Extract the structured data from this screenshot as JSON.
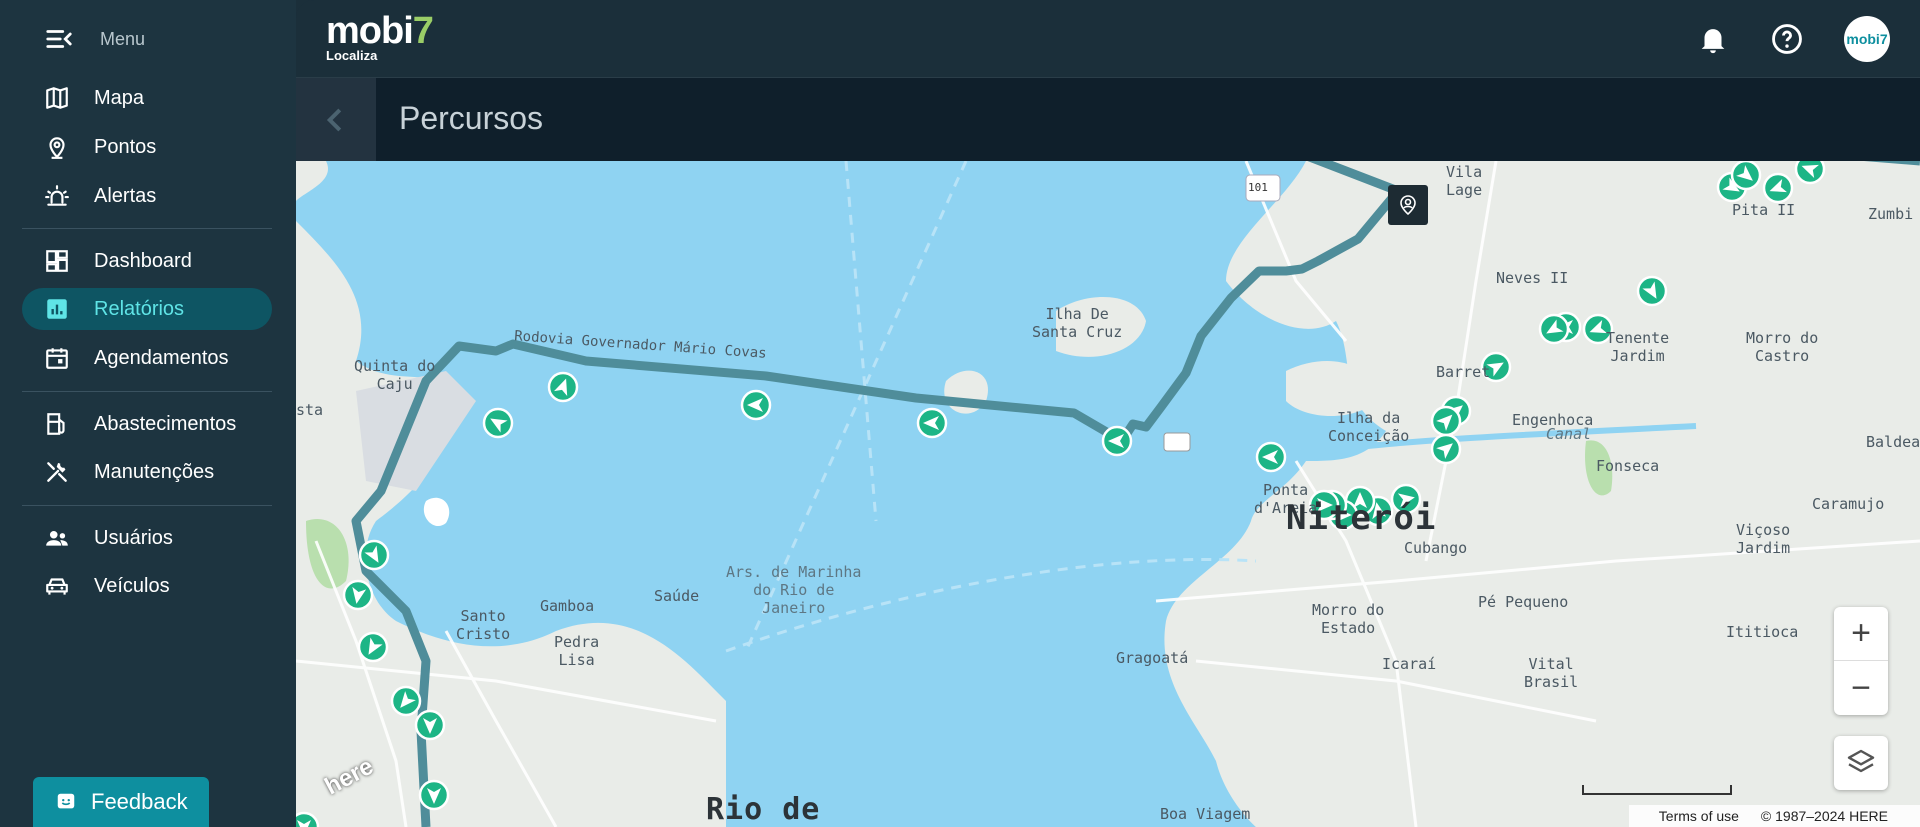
{
  "sidebar": {
    "menu_label": "Menu",
    "groups": [
      [
        {
          "label": "Mapa",
          "icon": "map-icon"
        },
        {
          "label": "Pontos",
          "icon": "location-pin-icon"
        },
        {
          "label": "Alertas",
          "icon": "siren-icon"
        }
      ],
      [
        {
          "label": "Dashboard",
          "icon": "dashboard-icon"
        },
        {
          "label": "Relatórios",
          "icon": "bar-chart-icon",
          "active": true
        },
        {
          "label": "Agendamentos",
          "icon": "calendar-icon"
        }
      ],
      [
        {
          "label": "Abastecimentos",
          "icon": "fuel-pump-icon"
        },
        {
          "label": "Manutenções",
          "icon": "wrench-icon"
        }
      ],
      [
        {
          "label": "Usuários",
          "icon": "users-icon"
        },
        {
          "label": "Veículos",
          "icon": "car-icon"
        }
      ]
    ],
    "feedback_label": "Feedback"
  },
  "topbar": {
    "logo_text": "mobi",
    "logo_accent": "7",
    "logo_sub": "Localiza",
    "avatar_text": "mobi7"
  },
  "page": {
    "title": "Percursos"
  },
  "map": {
    "labels": {
      "vila_lage": "Vila\nLage",
      "pita_ii": "Pita II",
      "zumbi": "Zumbi",
      "neves_ii": "Neves II",
      "ilha_santa_cruz": "Ilha De\nSanta Cruz",
      "tenente_jardim": "Tenente\nJardim",
      "morro_castro": "Morro do\nCastro",
      "barreto": "Barret",
      "ilha_conceicao": "Ilha da\nConceição",
      "engenhoca": "Engenhoca",
      "baldeador": "Baldead",
      "quinta_caju": "Quinta do\nCaju",
      "ponta_areia": "Ponta\nd'Areia",
      "canal": "Canal",
      "fonseca": "Fonseca",
      "caramujo": "Caramujo",
      "niteroi": "Niterói",
      "cubango": "Cubango",
      "vicoso_jardim": "Viçoso\nJardim",
      "ars_marinha": "Ars. de Marinha\ndo Rio de\nJaneiro",
      "gamboa": "Gamboa",
      "saude": "Saúde",
      "santo_cristo": "Santo\nCristo",
      "pedra_lisa": "Pedra\nLisa",
      "morro_estado": "Morro do\nEstado",
      "pe_pequeno": "Pé Pequeno",
      "gragoata": "Gragoatá",
      "icarai": "Icaraí",
      "vital_brasil": "Vital\nBrasil",
      "ititioca": "Ititioca",
      "boa_viagem": "Boa Viagem",
      "rio_de": "Rio de",
      "rodovia": "Rodovia Governador Mário Covas",
      "sta": "sta",
      "route_101": "101"
    },
    "zoom_in": "+",
    "zoom_out": "−",
    "terms": "Terms of use",
    "copyright": "© 1987–2024 HERE",
    "here_logo": "here"
  },
  "colors": {
    "accent": "#0e8f9f",
    "route": "#4f8d9a",
    "marker": "#1db586",
    "active_text": "#5fe4e6"
  }
}
